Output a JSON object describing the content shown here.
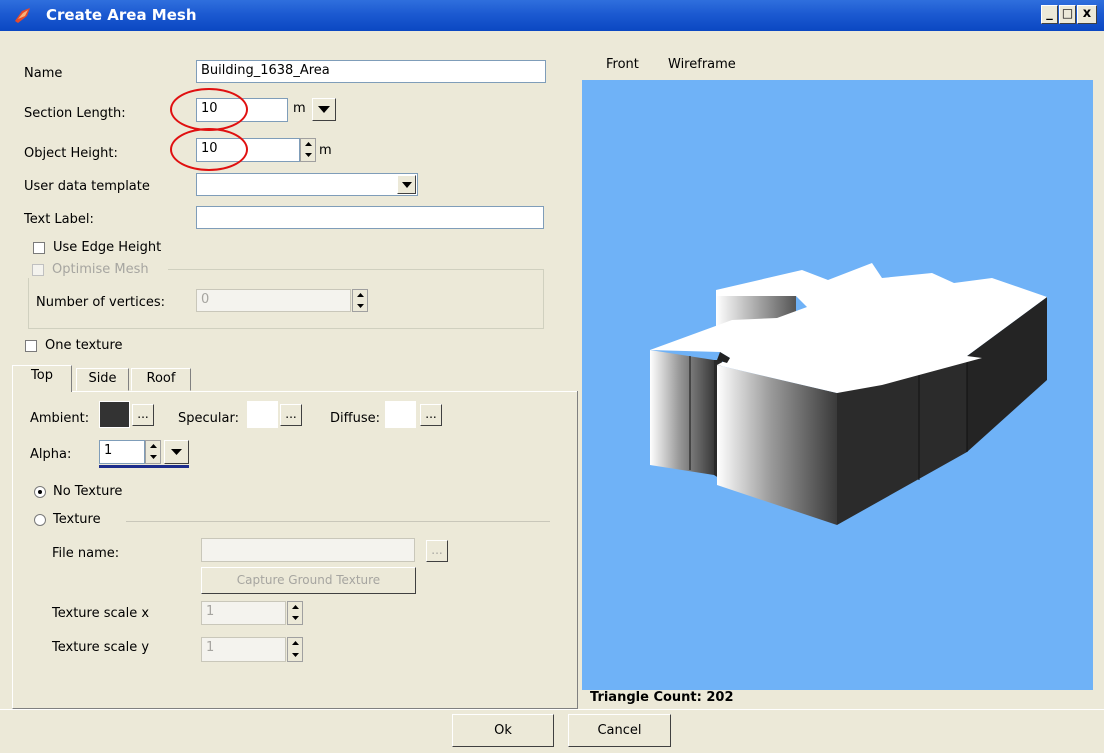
{
  "window": {
    "title": "Create Area Mesh",
    "controls": {
      "minimize": "_",
      "maximize": "□",
      "close": "x"
    }
  },
  "form": {
    "name_label": "Name",
    "name_value": "Building_1638_Area",
    "section_length_label": "Section Length:",
    "section_length_value": "10",
    "section_length_unit": "m",
    "object_height_label": "Object Height:",
    "object_height_value": "10",
    "object_height_unit": "m",
    "user_data_template_label": "User data template",
    "user_data_template_value": "",
    "text_label_label": "Text Label:",
    "text_label_value": "",
    "use_edge_height_label": "Use Edge Height",
    "optimise_mesh_label": "Optimise Mesh",
    "number_of_vertices_label": "Number of vertices:",
    "number_of_vertices_value": "0",
    "one_texture_label": "One texture"
  },
  "tabs": [
    {
      "label": "Top",
      "active": true
    },
    {
      "label": "Side",
      "active": false
    },
    {
      "label": "Roof",
      "active": false
    }
  ],
  "material": {
    "ambient_label": "Ambient:",
    "ambient_color": "#333333",
    "specular_label": "Specular:",
    "specular_color": "#ffffff",
    "diffuse_label": "Diffuse:",
    "diffuse_color": "#ffffff",
    "browse_label": "...",
    "alpha_label": "Alpha:",
    "alpha_value": "1"
  },
  "texture": {
    "no_texture_label": "No Texture",
    "no_texture_selected": true,
    "texture_label": "Texture",
    "file_name_label": "File name:",
    "file_name_value": "",
    "capture_button": "Capture Ground Texture",
    "scale_x_label": "Texture scale x",
    "scale_x_value": "1",
    "scale_y_label": "Texture scale y",
    "scale_y_value": "1"
  },
  "viewport": {
    "menu": [
      "Front",
      "Wireframe"
    ],
    "background_color": "#6fb2f7",
    "triangle_count": "Triangle Count: 202"
  },
  "footer": {
    "ok": "Ok",
    "cancel": "Cancel"
  }
}
